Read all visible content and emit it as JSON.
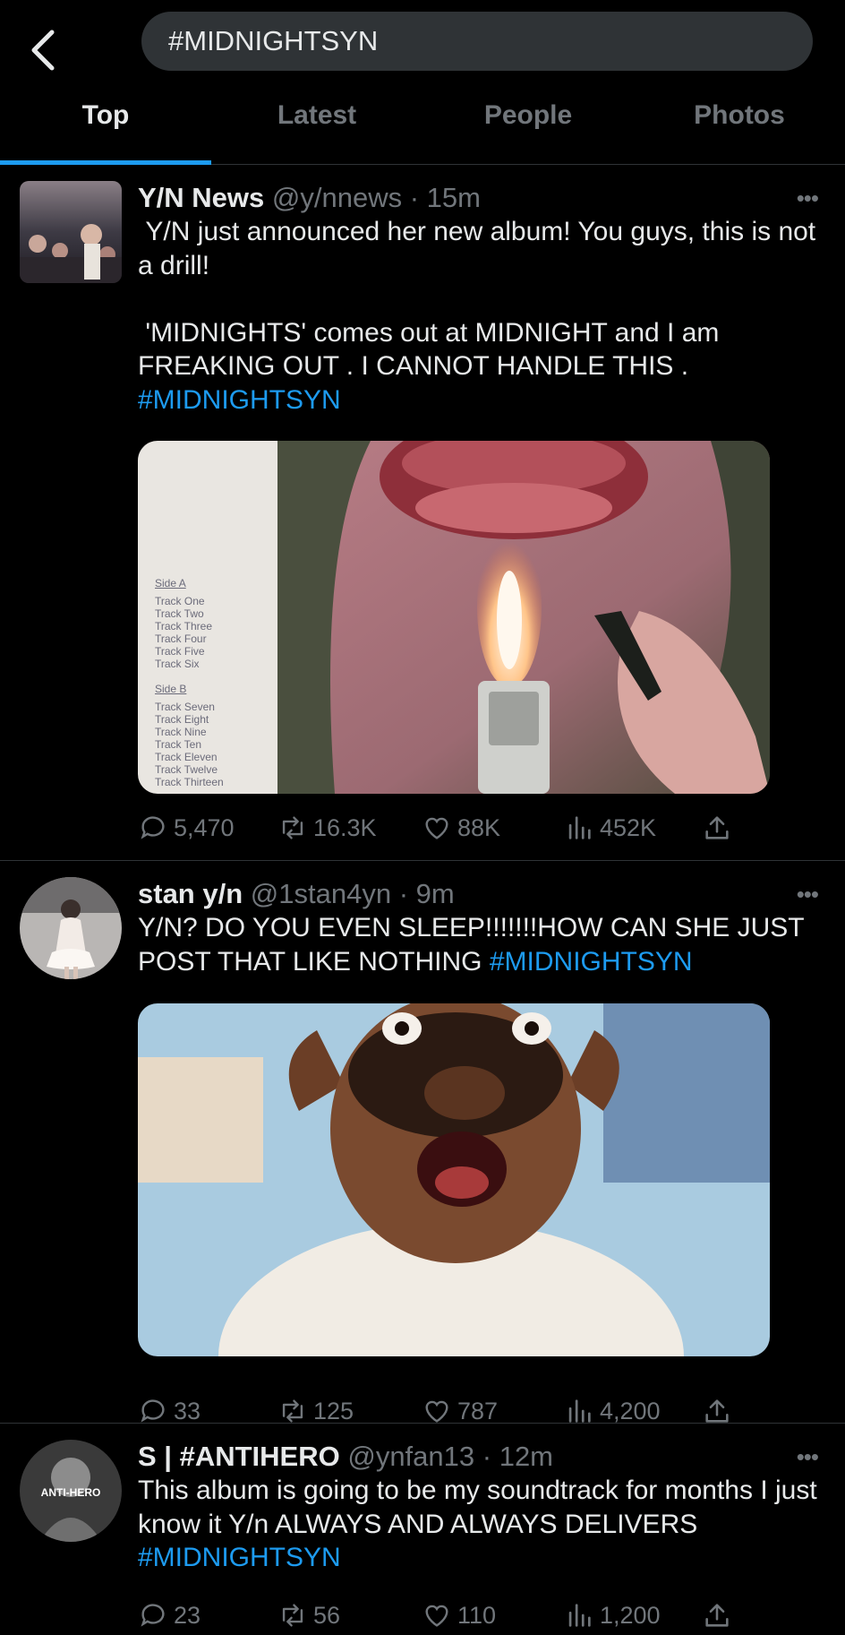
{
  "search": {
    "query": "#MIDNIGHTSYN"
  },
  "tabs": [
    {
      "label": "Top"
    },
    {
      "label": "Latest"
    },
    {
      "label": "People"
    },
    {
      "label": "Photos"
    }
  ],
  "tweets": [
    {
      "name": "Y/N News",
      "handle": "@y/nnews",
      "time": "15m",
      "text": " Y/N just announced her new album! You guys, this is not a drill!\n\n 'MIDNIGHTS' comes out at MIDNIGHT and I am FREAKING OUT . I CANNOT HANDLE THIS .\n",
      "hashtag": "#MIDNIGHTSYN",
      "media": {
        "side_a_label": "Side A",
        "side_a_tracks": [
          "Track One",
          "Track Two",
          "Track Three",
          "Track Four",
          "Track Five",
          "Track Six"
        ],
        "side_b_label": "Side B",
        "side_b_tracks": [
          "Track Seven",
          "Track Eight",
          "Track Nine",
          "Track Ten",
          "Track Eleven",
          "Track Twelve",
          "Track Thirteen"
        ]
      },
      "replies": "5,470",
      "retweets": "16.3K",
      "likes": "88K",
      "views": "452K"
    },
    {
      "name": "stan y/n",
      "handle": "@1stan4yn",
      "time": "9m",
      "text": "Y/N? DO YOU EVEN SLEEP!!!!!!!HOW CAN SHE JUST POST THAT LIKE NOTHING ",
      "hashtag": "#MIDNIGHTSYN",
      "replies": "33",
      "retweets": "125",
      "likes": "787",
      "views": "4,200"
    },
    {
      "name": "S | #ANTIHERO",
      "handle": "@ynfan13",
      "time": "12m",
      "avatar_text": "ANTI-HERO",
      "text": "This album is going to be my soundtrack for months I just know it Y/n ALWAYS AND ALWAYS DELIVERS\n",
      "hashtag": "#MIDNIGHTSYN",
      "replies": "23",
      "retweets": "56",
      "likes": "110",
      "views": "1,200"
    }
  ],
  "colors": {
    "accent": "#1d9bf0",
    "muted": "#71767b",
    "background": "#000000",
    "search_bg": "#2f3336"
  }
}
